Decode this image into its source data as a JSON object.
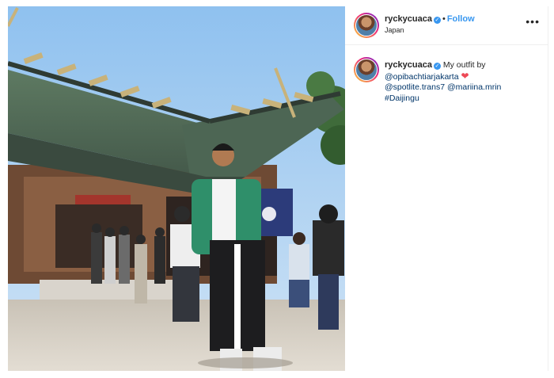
{
  "post": {
    "image_alt": "",
    "header": {
      "username": "ryckycuaca",
      "separator": "•",
      "follow_label": "Follow",
      "location": "Japan",
      "more_icon": "more-options-icon"
    },
    "caption": {
      "username": "ryckycuaca",
      "text": "My outfit by",
      "mention_1": "@opibachtiarjakarta",
      "emoji": "❤",
      "mention_2": "@spotlite.trans7",
      "mention_3": "@mariina.mrin",
      "hashtag": "#Daijingu"
    }
  },
  "colors": {
    "link_blue": "#3897f0",
    "mention_blue": "#003569",
    "heart_red": "#ed4956"
  }
}
